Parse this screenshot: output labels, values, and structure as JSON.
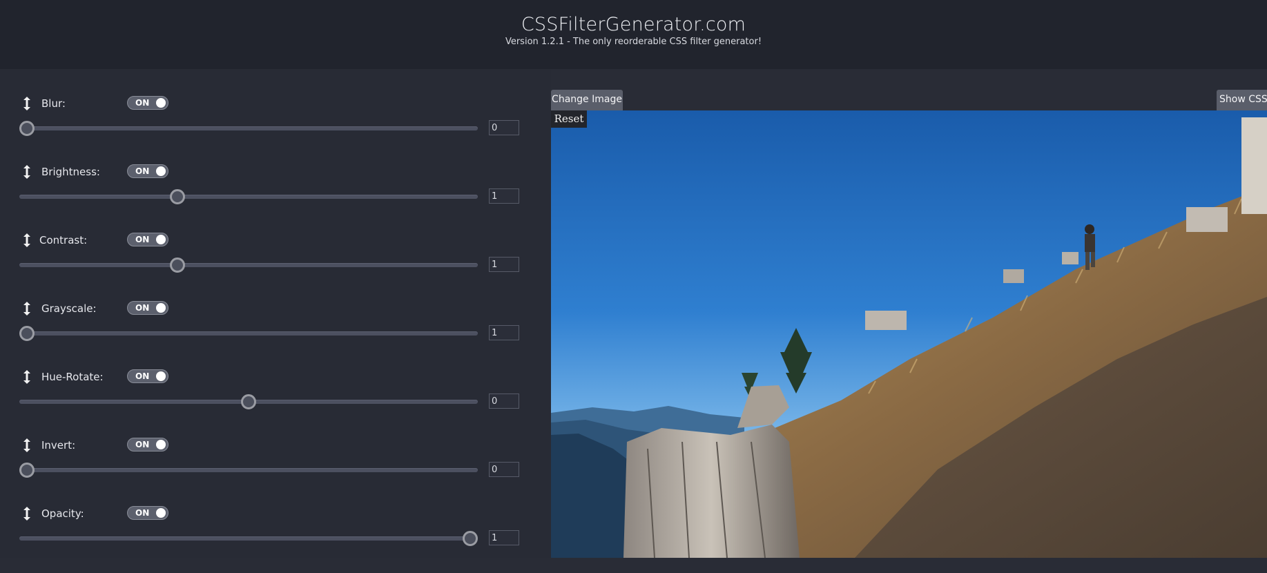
{
  "header": {
    "title": "CSSFilterGenerator.com",
    "subtitle": "Version 1.2.1 - The only reorderable CSS filter generator!"
  },
  "filters": [
    {
      "label": "Blur:",
      "toggle": "ON",
      "value": "0",
      "slider_fraction": 0.0
    },
    {
      "label": "Brightness:",
      "toggle": "ON",
      "value": "1",
      "slider_fraction": 0.34
    },
    {
      "label": "Contrast:",
      "toggle": "ON",
      "value": "1",
      "slider_fraction": 0.34
    },
    {
      "label": "Grayscale:",
      "toggle": "ON",
      "value": "1",
      "slider_fraction": 0.0
    },
    {
      "label": "Hue-Rotate:",
      "toggle": "ON",
      "value": "0",
      "slider_fraction": 0.5
    },
    {
      "label": "Invert:",
      "toggle": "ON",
      "value": "0",
      "slider_fraction": 0.0
    },
    {
      "label": "Opacity:",
      "toggle": "ON",
      "value": "1",
      "slider_fraction": 1.0
    }
  ],
  "preview": {
    "change_image_label": "Change Image",
    "show_css_label": "Show CSS",
    "reset_label": "Reset"
  },
  "colors": {
    "header_bg": "#21242d",
    "panel_bg": "#282b35",
    "toggle_bg": "#5c606d",
    "sky_top": "#1c5fae",
    "sky_bottom": "#8ec3ee"
  }
}
